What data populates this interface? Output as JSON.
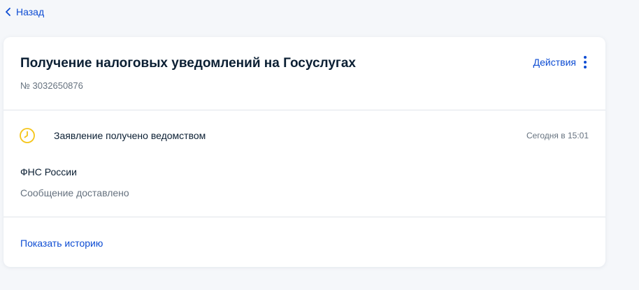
{
  "nav": {
    "back_label": "Назад"
  },
  "card": {
    "title": "Получение налоговых уведомлений на Госуслугах",
    "number": "№ 3032650876",
    "actions_label": "Действия",
    "status": {
      "icon": "clock-icon",
      "text": "Заявление получено ведомством",
      "time": "Сегодня в 15:01"
    },
    "organization": "ФНС России",
    "message": "Сообщение доставлено",
    "history_link": "Показать историю"
  },
  "colors": {
    "link": "#0d4cd3",
    "status_icon": "#f5c518",
    "text_primary": "#0b1f33",
    "text_secondary": "#66727f"
  }
}
